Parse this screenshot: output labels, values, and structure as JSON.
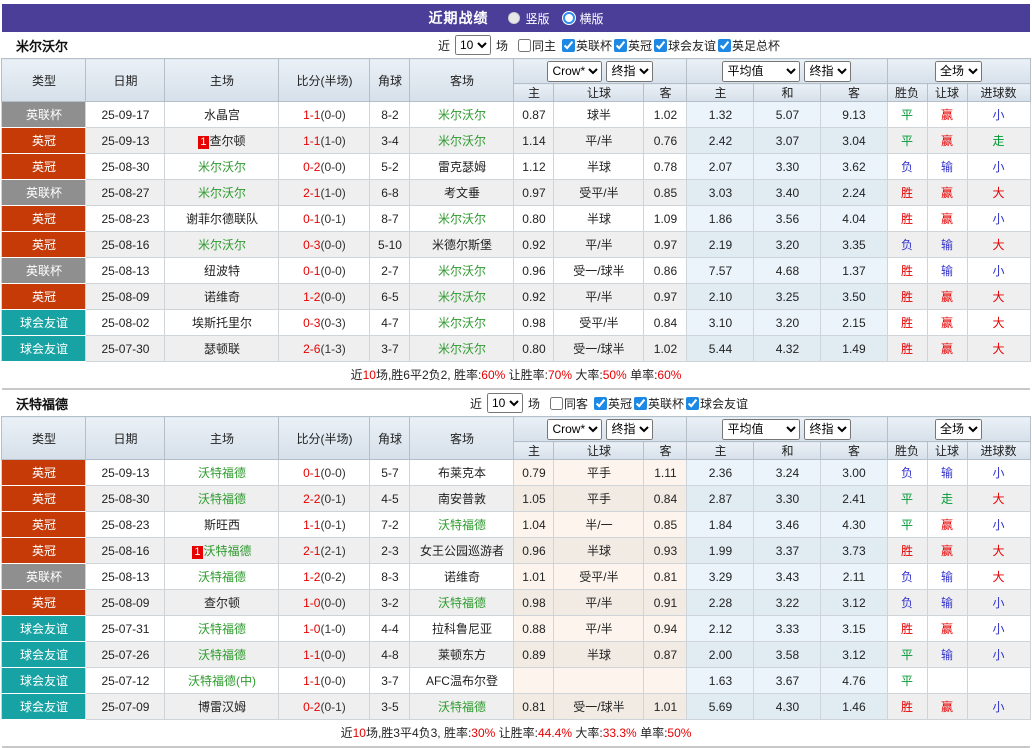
{
  "title_bar": {
    "title": "近期战绩",
    "views": [
      {
        "label": "竖版",
        "style": "filled",
        "selected": true
      },
      {
        "label": "横版",
        "style": "ring",
        "selected": false
      }
    ]
  },
  "columns": {
    "type": "类型",
    "date": "日期",
    "home": "主场",
    "score": "比分(半场)",
    "corner": "角球",
    "away": "客场",
    "crow_select": "Crow*",
    "stage_select": "终指",
    "avg_select": "平均值",
    "scope_select": "全场",
    "odds_home": "主",
    "odds_handicap": "让球",
    "odds_away": "客",
    "avg_home": "主",
    "avg_draw": "和",
    "avg_away": "客",
    "result": "胜负",
    "result_handicap": "让球",
    "result_goals": "进球数",
    "recent": "近",
    "matches": "场"
  },
  "league_colors": {
    "英冠": "#c63a08",
    "英联杯": "#8f8f8f",
    "球会友谊": "#17a3a3"
  },
  "result_colors": {
    "胜": "red",
    "平": "green",
    "负": "blue",
    "赢": "red",
    "输": "blue",
    "走": "green",
    "大": "red",
    "小": "blue"
  },
  "colors": {
    "accent_purple": "#4a3e99",
    "score_red": "#e60000",
    "team_green": "#2e9b2e"
  },
  "sections": [
    {
      "team": "米尔沃尔",
      "filters": {
        "count": "10",
        "same_label": "同主",
        "same_checked": false,
        "leagues": [
          "英联杯",
          "英冠",
          "球会友谊",
          "英足总杯"
        ]
      },
      "rows": [
        {
          "type": "英联杯",
          "date": "25-09-17",
          "home": "水晶宫",
          "score": "1-1",
          "half": "(0-0)",
          "corner": "8-2",
          "away": "米尔沃尔",
          "away_green": true,
          "crow": [
            "0.87",
            "球半",
            "1.02"
          ],
          "avg": [
            "1.32",
            "5.07",
            "9.13"
          ],
          "res": [
            "平",
            "赢",
            "小"
          ]
        },
        {
          "type": "英冠",
          "date": "25-09-13",
          "home": "查尔顿",
          "home_badge": "1",
          "score": "1-1",
          "half": "(1-0)",
          "corner": "3-4",
          "away": "米尔沃尔",
          "away_green": true,
          "crow": [
            "1.14",
            "平/半",
            "0.76"
          ],
          "avg": [
            "2.42",
            "3.07",
            "3.04"
          ],
          "res": [
            "平",
            "赢",
            "走"
          ]
        },
        {
          "type": "英冠",
          "date": "25-08-30",
          "home": "米尔沃尔",
          "home_green": true,
          "score": "0-2",
          "half": "(0-0)",
          "corner": "5-2",
          "away": "雷克瑟姆",
          "crow": [
            "1.12",
            "半球",
            "0.78"
          ],
          "avg": [
            "2.07",
            "3.30",
            "3.62"
          ],
          "res": [
            "负",
            "输",
            "小"
          ]
        },
        {
          "type": "英联杯",
          "date": "25-08-27",
          "home": "米尔沃尔",
          "home_green": true,
          "score": "2-1",
          "half": "(1-0)",
          "corner": "6-8",
          "away": "考文垂",
          "crow": [
            "0.97",
            "受平/半",
            "0.85"
          ],
          "avg": [
            "3.03",
            "3.40",
            "2.24"
          ],
          "res": [
            "胜",
            "赢",
            "大"
          ]
        },
        {
          "type": "英冠",
          "date": "25-08-23",
          "home": "谢菲尔德联队",
          "score": "0-1",
          "half": "(0-1)",
          "corner": "8-7",
          "away": "米尔沃尔",
          "away_green": true,
          "crow": [
            "0.80",
            "半球",
            "1.09"
          ],
          "avg": [
            "1.86",
            "3.56",
            "4.04"
          ],
          "res": [
            "胜",
            "赢",
            "小"
          ]
        },
        {
          "type": "英冠",
          "date": "25-08-16",
          "home": "米尔沃尔",
          "home_green": true,
          "score": "0-3",
          "half": "(0-0)",
          "corner": "5-10",
          "away": "米德尔斯堡",
          "crow": [
            "0.92",
            "平/半",
            "0.97"
          ],
          "avg": [
            "2.19",
            "3.20",
            "3.35"
          ],
          "res": [
            "负",
            "输",
            "大"
          ]
        },
        {
          "type": "英联杯",
          "date": "25-08-13",
          "home": "纽波特",
          "score": "0-1",
          "half": "(0-0)",
          "corner": "2-7",
          "away": "米尔沃尔",
          "away_green": true,
          "crow": [
            "0.96",
            "受一/球半",
            "0.86"
          ],
          "avg": [
            "7.57",
            "4.68",
            "1.37"
          ],
          "res": [
            "胜",
            "输",
            "小"
          ]
        },
        {
          "type": "英冠",
          "date": "25-08-09",
          "home": "诺维奇",
          "score": "1-2",
          "half": "(0-0)",
          "corner": "6-5",
          "away": "米尔沃尔",
          "away_green": true,
          "crow": [
            "0.92",
            "平/半",
            "0.97"
          ],
          "avg": [
            "2.10",
            "3.25",
            "3.50"
          ],
          "res": [
            "胜",
            "赢",
            "大"
          ]
        },
        {
          "type": "球会友谊",
          "date": "25-08-02",
          "home": "埃斯托里尔",
          "score": "0-3",
          "half": "(0-3)",
          "corner": "4-7",
          "away": "米尔沃尔",
          "away_green": true,
          "crow": [
            "0.98",
            "受平/半",
            "0.84"
          ],
          "avg": [
            "3.10",
            "3.20",
            "2.15"
          ],
          "res": [
            "胜",
            "赢",
            "大"
          ]
        },
        {
          "type": "球会友谊",
          "date": "25-07-30",
          "home": "瑟顿联",
          "score": "2-6",
          "half": "(1-3)",
          "corner": "3-7",
          "away": "米尔沃尔",
          "away_green": true,
          "crow": [
            "0.80",
            "受一/球半",
            "1.02"
          ],
          "avg": [
            "5.44",
            "4.32",
            "1.49"
          ],
          "res": [
            "胜",
            "赢",
            "大"
          ]
        }
      ],
      "summary": [
        {
          "t": "近"
        },
        {
          "t": "10",
          "red": true
        },
        {
          "t": "场,胜6平2负2, 胜率:"
        },
        {
          "t": "60%",
          "red": true
        },
        {
          "t": " 让胜率:"
        },
        {
          "t": "70%",
          "red": true
        },
        {
          "t": " 大率:"
        },
        {
          "t": "50%",
          "red": true
        },
        {
          "t": " 单率:"
        },
        {
          "t": "60%",
          "red": true
        }
      ]
    },
    {
      "team": "沃特福德",
      "filters": {
        "count": "10",
        "same_label": "同客",
        "same_checked": false,
        "leagues": [
          "英冠",
          "英联杯",
          "球会友谊"
        ]
      },
      "rows": [
        {
          "type": "英冠",
          "date": "25-09-13",
          "home": "沃特福德",
          "home_green": true,
          "score": "0-1",
          "half": "(0-0)",
          "corner": "5-7",
          "away": "布莱克本",
          "crow": [
            "0.79",
            "平手",
            "1.11"
          ],
          "avg": [
            "2.36",
            "3.24",
            "3.00"
          ],
          "res": [
            "负",
            "输",
            "小"
          ]
        },
        {
          "type": "英冠",
          "date": "25-08-30",
          "home": "沃特福德",
          "home_green": true,
          "score": "2-2",
          "half": "(0-1)",
          "corner": "4-5",
          "away": "南安普敦",
          "crow": [
            "1.05",
            "平手",
            "0.84"
          ],
          "avg": [
            "2.87",
            "3.30",
            "2.41"
          ],
          "res": [
            "平",
            "走",
            "大"
          ]
        },
        {
          "type": "英冠",
          "date": "25-08-23",
          "home": "斯旺西",
          "score": "1-1",
          "half": "(0-1)",
          "corner": "7-2",
          "away": "沃特福德",
          "away_green": true,
          "crow": [
            "1.04",
            "半/一",
            "0.85"
          ],
          "avg": [
            "1.84",
            "3.46",
            "4.30"
          ],
          "res": [
            "平",
            "赢",
            "小"
          ]
        },
        {
          "type": "英冠",
          "date": "25-08-16",
          "home": "沃特福德",
          "home_green": true,
          "home_badge": "1",
          "score": "2-1",
          "half": "(2-1)",
          "corner": "2-3",
          "away": "女王公园巡游者",
          "crow": [
            "0.96",
            "半球",
            "0.93"
          ],
          "avg": [
            "1.99",
            "3.37",
            "3.73"
          ],
          "res": [
            "胜",
            "赢",
            "大"
          ]
        },
        {
          "type": "英联杯",
          "date": "25-08-13",
          "home": "沃特福德",
          "home_green": true,
          "score": "1-2",
          "half": "(0-2)",
          "corner": "8-3",
          "away": "诺维奇",
          "crow": [
            "1.01",
            "受平/半",
            "0.81"
          ],
          "avg": [
            "3.29",
            "3.43",
            "2.11"
          ],
          "res": [
            "负",
            "输",
            "大"
          ]
        },
        {
          "type": "英冠",
          "date": "25-08-09",
          "home": "查尔顿",
          "score": "1-0",
          "half": "(0-0)",
          "corner": "3-2",
          "away": "沃特福德",
          "away_green": true,
          "crow": [
            "0.98",
            "平/半",
            "0.91"
          ],
          "avg": [
            "2.28",
            "3.22",
            "3.12"
          ],
          "res": [
            "负",
            "输",
            "小"
          ]
        },
        {
          "type": "球会友谊",
          "date": "25-07-31",
          "home": "沃特福德",
          "home_green": true,
          "score": "1-0",
          "half": "(1-0)",
          "corner": "4-4",
          "away": "拉科鲁尼亚",
          "crow": [
            "0.88",
            "平/半",
            "0.94"
          ],
          "avg": [
            "2.12",
            "3.33",
            "3.15"
          ],
          "res": [
            "胜",
            "赢",
            "小"
          ]
        },
        {
          "type": "球会友谊",
          "date": "25-07-26",
          "home": "沃特福德",
          "home_green": true,
          "score": "1-1",
          "half": "(0-0)",
          "corner": "4-8",
          "away": "莱顿东方",
          "crow": [
            "0.89",
            "半球",
            "0.87"
          ],
          "avg": [
            "2.00",
            "3.58",
            "3.12"
          ],
          "res": [
            "平",
            "输",
            "小"
          ]
        },
        {
          "type": "球会友谊",
          "date": "25-07-12",
          "home": "沃特福德(中)",
          "home_green": true,
          "score": "1-1",
          "half": "(0-0)",
          "corner": "3-7",
          "away": "AFC温布尔登",
          "crow": [
            "",
            "",
            ""
          ],
          "avg": [
            "1.63",
            "3.67",
            "4.76"
          ],
          "res": [
            "平",
            "",
            ""
          ]
        },
        {
          "type": "球会友谊",
          "date": "25-07-09",
          "home": "博雷汉姆",
          "score": "0-2",
          "half": "(0-1)",
          "corner": "3-5",
          "away": "沃特福德",
          "away_green": true,
          "crow": [
            "0.81",
            "受一/球半",
            "1.01"
          ],
          "avg": [
            "5.69",
            "4.30",
            "1.46"
          ],
          "res": [
            "胜",
            "赢",
            "小"
          ]
        }
      ],
      "summary": [
        {
          "t": "近"
        },
        {
          "t": "10",
          "red": true
        },
        {
          "t": "场,胜3平4负3, 胜率:"
        },
        {
          "t": "30%",
          "red": true
        },
        {
          "t": " 让胜率:"
        },
        {
          "t": "44.4%",
          "red": true
        },
        {
          "t": " 大率:"
        },
        {
          "t": "33.3%",
          "red": true
        },
        {
          "t": " 单率:"
        },
        {
          "t": "50%",
          "red": true
        }
      ]
    }
  ]
}
